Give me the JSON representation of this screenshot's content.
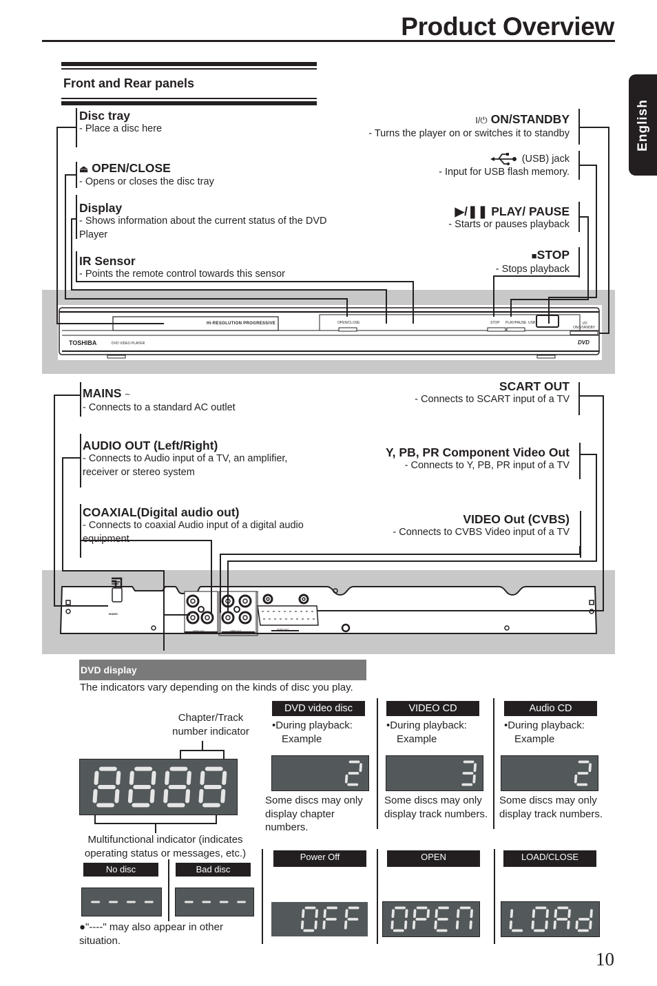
{
  "page": {
    "title": "Product Overview",
    "language_tab": "English",
    "page_number": "10"
  },
  "section": {
    "title": "Front and Rear panels"
  },
  "front_left": [
    {
      "icon": "",
      "title": "Disc tray",
      "desc": "- Place a disc here"
    },
    {
      "icon": "eject-icon",
      "title": "OPEN/CLOSE",
      "desc": "- Opens or closes the disc tray"
    },
    {
      "icon": "",
      "title": "Display",
      "desc": "- Shows information about the current status of the DVD Player"
    },
    {
      "icon": "",
      "title": "IR Sensor",
      "desc": "- Points the remote control towards this sensor"
    }
  ],
  "front_right": [
    {
      "icon": "power-icon",
      "prefix": "I/⏻",
      "title": "ON/STANDBY",
      "desc": "- Turns the player on or switches it to standby"
    },
    {
      "icon": "usb-icon",
      "title": "(USB) jack",
      "desc": "- Input for USB flash memory."
    },
    {
      "icon": "play-pause-icon",
      "prefix": "▶/❚❚",
      "title": "PLAY/ PAUSE",
      "desc": "- Starts or pauses playback"
    },
    {
      "icon": "stop-icon",
      "prefix": "■",
      "title": "STOP",
      "desc": "- Stops playback"
    }
  ],
  "front_panel": {
    "brand": "TOSHIBA",
    "model_text": "DVD VIDEO PLAYER",
    "display_text": "Hi-RESOLUTION PROGRESSIVE",
    "open_close": "OPEN/CLOSE",
    "stop": "STOP",
    "play_pause": "PLAY/PAUSE",
    "usb": "USB",
    "standby_1": "I/O",
    "standby_2": "ON/STANDBY",
    "dvd_logo": "DVD"
  },
  "rear_left": [
    {
      "title": "MAINS",
      "suffix": "~",
      "desc": "- Connects to a standard AC outlet"
    },
    {
      "title": "AUDIO OUT (Left/Right)",
      "desc": "- Connects to Audio input of a TV, an amplifier, receiver or stereo system"
    },
    {
      "title": "COAXIAL(Digital audio out)",
      "desc": "- Connects to coaxial Audio input of a digital audio equipment"
    }
  ],
  "rear_right": [
    {
      "title": "SCART OUT",
      "desc": "- Connects to SCART input of a TV"
    },
    {
      "title": "Y, PB, PR Component Video Out",
      "desc": "- Connects to Y, PB, PR input of a TV"
    },
    {
      "title": "VIDEO Out (CVBS)",
      "desc": "- Connects to CVBS  Video input  of a TV"
    }
  ],
  "rear_panel": {
    "mains": "MAINS",
    "audio_out": "AUDIO OUT",
    "video_out": "VIDEO OUT",
    "scart_out": "SCART OUT",
    "coaxial": "COAXIAL DIGITAL OUT"
  },
  "dvd_display": {
    "header": "DVD display",
    "intro": "The indicators vary depending on the kinds of disc you play.",
    "chapter_label_1": "Chapter/Track",
    "chapter_label_2": "number indicator",
    "multi_label_1": "Multifunctional indicator (indicates",
    "multi_label_2": "operating status or messages, etc.)",
    "main_digits": "8888",
    "no_disc": {
      "label": "No disc",
      "readout": "----"
    },
    "bad_disc": {
      "label": "Bad disc",
      "readout": "----"
    },
    "note": "●\"----\" may also appear in other situation.",
    "disc_types": [
      {
        "label": "DVD video disc",
        "line1": "•During playback:",
        "line2": "Example",
        "readout": "2",
        "note": "Some discs may only display chapter numbers."
      },
      {
        "label": "VIDEO CD",
        "line1": "•During playback:",
        "line2": "Example",
        "readout": "3",
        "note": "Some discs may only display track numbers."
      },
      {
        "label": "Audio CD",
        "line1": "•During playback:",
        "line2": "Example",
        "readout": "2",
        "note": "Some discs may only display track numbers."
      }
    ],
    "states": [
      {
        "label": "Power Off",
        "readout": "OFF"
      },
      {
        "label": "OPEN",
        "readout": "OPEN"
      },
      {
        "label": "LOAD/CLOSE",
        "readout": "LOAd"
      }
    ]
  },
  "colors": {
    "ink": "#231f20",
    "band_gray": "#c8c8c8",
    "lcd_bg": "#53595b",
    "lcd_segment": "#e6e6e6",
    "header_gray": "#7a7a7a"
  }
}
